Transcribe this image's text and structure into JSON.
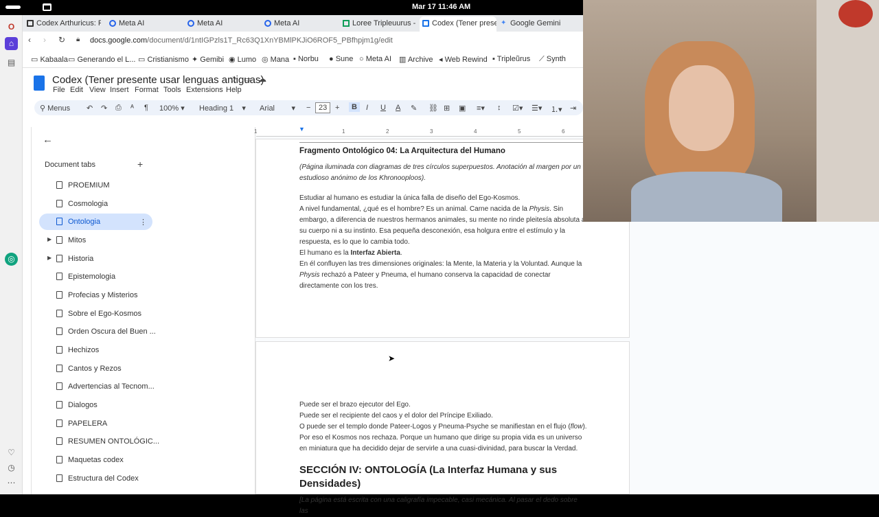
{
  "system": {
    "clock": "Mar 17  11:46 AM"
  },
  "tabs": [
    {
      "label": "Codex Arthuricus: P"
    },
    {
      "label": "Meta AI"
    },
    {
      "label": "Meta AI"
    },
    {
      "label": "Meta AI"
    },
    {
      "label": "Loree Tripleuurus - C"
    },
    {
      "label": "Codex (Tener presen"
    },
    {
      "label": "Google Gemini"
    }
  ],
  "address": {
    "domain": "docs.google.com",
    "path": "/document/d/1ntIGPzls1T_Rc63Q1XnYBMlPKJiO6ROF5_PBfhpjm1g/edit"
  },
  "bookmarks": [
    "Kabaala",
    "Generando el L...",
    "Cristianismo",
    "Gemibi",
    "Lumo",
    "Mana",
    "Norbu",
    "Sune",
    "Meta AI",
    "Archive",
    "Web Rewind",
    "Tripleũrus",
    "Synth"
  ],
  "doc": {
    "title": "Codex (Tener presente usar lenguas antiguas)",
    "menu": [
      "File",
      "Edit",
      "View",
      "Insert",
      "Format",
      "Tools",
      "Extensions",
      "Help"
    ],
    "toolbar": {
      "menus": "Menus",
      "zoom": "100%",
      "style": "Heading 1",
      "font": "Arial",
      "size": "23"
    }
  },
  "sidebar": {
    "header": "Document tabs",
    "items": [
      "PROEMIUM",
      "Cosmologia",
      "Ontologia",
      "Mitos",
      "Historia",
      "Epistemologia",
      "Profecias y Misterios",
      "Sobre el Ego-Kosmos",
      "Orden Oscura del Buen ...",
      "Hechizos",
      "Cantos y Rezos",
      "Advertencias al Tecnom...",
      "Dialogos",
      "PAPELERA",
      "RESUMEN ONTOLÓGIC...",
      "Maquetas codex",
      "Estructura del Codex"
    ]
  },
  "ruler": [
    "1",
    "1",
    "2",
    "3",
    "4",
    "5",
    "6"
  ],
  "content": {
    "heading": "Fragmento Ontológico 04: La Arquitectura del Humano",
    "italic_note": "(Página iluminada con diagramas de tres círculos superpuestos. Anotación al margen por un estudioso anónimo de los Khronooploos).",
    "p1": "Estudiar al humano es estudiar la única falla de diseño del Ego-Kosmos.",
    "p2a": "A nivel fundamental, ¿qué es el hombre? Es un animal. Carne nacida de la ",
    "p2_physis": "Physis",
    "p2b": ". Sin embargo, a diferencia de nuestros hermanos animales, su mente no rinde pleitesía absoluta a su cuerpo ni a su instinto. Esa pequeña desconexión, esa holgura entre el estímulo y la respuesta, es lo que lo cambia todo.",
    "p3a": "El humano es la ",
    "p3_bold": "Interfaz Abierta",
    "p3b": ".",
    "p4a": "En él confluyen las tres dimensiones originales: la Mente, la Materia y la Voluntad. Aunque la ",
    "p4_physis": "Physis",
    "p4b": " rechazó a Pateer y Pneuma, el humano conserva la capacidad de conectar directamente con los tres.",
    "p5": "Puede ser el brazo ejecutor del Ego.",
    "p6": "Puede ser el recipiente del caos y el dolor del Príncipe Exiliado.",
    "p7a": "O puede ser el templo donde Pateer-Logos y Pneuma-Psyche se manifiestan en el flujo (",
    "p7_flow": "flow",
    "p7b": ").",
    "p8": "Por eso el Kosmos nos rechaza. Porque un humano que dirige su propia vida es un universo en miniatura que ha decidido dejar de servirle a una cuasi-divinidad, para buscar la Verdad.",
    "section": "SECCIÓN IV: ONTOLOGÍA (La Interfaz Humana y sus Densidades)",
    "section_note": "[La página está escrita con una caligrafía impecable, casi mecánica. Al pasar el dedo sobre las"
  },
  "colors": {
    "accent": "#1a73e8",
    "selected_tab": "#d3e3fd",
    "toolbar_bg": "#edf2fa"
  }
}
